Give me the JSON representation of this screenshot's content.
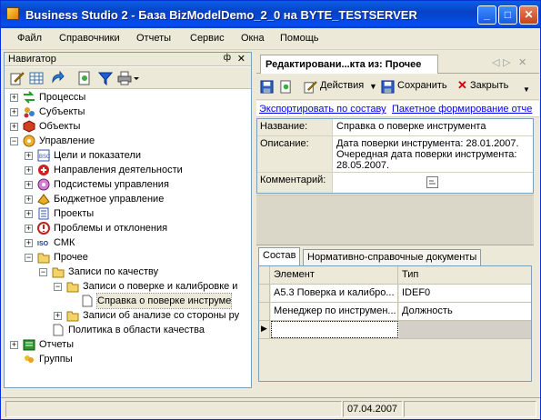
{
  "window": {
    "title": "Business Studio 2 - База BizModelDemo_2_0 на BYTE_TESTSERVER",
    "buttons": {
      "minimize": "_",
      "maximize": "□",
      "close": "✕"
    }
  },
  "menu": [
    "Файл",
    "Справочники",
    "Отчеты",
    "Сервис",
    "Окна",
    "Помощь"
  ],
  "navigator": {
    "title": "Навигатор",
    "pin": "ф",
    "close": "✕",
    "tree": [
      {
        "label": "Процессы",
        "level": 0,
        "expander": "+",
        "icon": "processes-icon"
      },
      {
        "label": "Субъекты",
        "level": 0,
        "expander": "+",
        "icon": "subjects-icon"
      },
      {
        "label": "Объекты",
        "level": 0,
        "expander": "+",
        "icon": "objects-icon"
      },
      {
        "label": "Управление",
        "level": 0,
        "expander": "−",
        "icon": "management-icon"
      },
      {
        "label": "Цели и показатели",
        "level": 1,
        "expander": "+",
        "icon": "bsc-icon"
      },
      {
        "label": "Направления деятельности",
        "level": 1,
        "expander": "+",
        "icon": "directions-icon"
      },
      {
        "label": "Подсистемы управления",
        "level": 1,
        "expander": "+",
        "icon": "subsystems-icon"
      },
      {
        "label": "Бюджетное управление",
        "level": 1,
        "expander": "+",
        "icon": "budget-icon"
      },
      {
        "label": "Проекты",
        "level": 1,
        "expander": "+",
        "icon": "projects-icon"
      },
      {
        "label": "Проблемы и отклонения",
        "level": 1,
        "expander": "+",
        "icon": "problems-icon"
      },
      {
        "label": "СМК",
        "level": 1,
        "expander": "+",
        "icon": "iso-icon"
      },
      {
        "label": "Прочее",
        "level": 1,
        "expander": "−",
        "icon": "folder-icon"
      },
      {
        "label": "Записи по качеству",
        "level": 2,
        "expander": "−",
        "icon": "folder-icon"
      },
      {
        "label": "Записи о поверке и калибровке и",
        "level": 3,
        "expander": "−",
        "icon": "folder-icon"
      },
      {
        "label": "Справка о поверке инструме",
        "level": 4,
        "expander": "",
        "icon": "document-icon",
        "selected": true
      },
      {
        "label": "Записи об анализе со стороны ру",
        "level": 3,
        "expander": "+",
        "icon": "folder-icon"
      },
      {
        "label": "Политика в области качества",
        "level": 2,
        "expander": "",
        "icon": "document-icon"
      },
      {
        "label": "Отчеты",
        "level": 0,
        "expander": "+",
        "icon": "reports-icon"
      },
      {
        "label": "Группы",
        "level": 0,
        "expander": "",
        "icon": "groups-icon"
      }
    ]
  },
  "editor": {
    "tab_title": "Редактировани...кта из: Прочее",
    "toolbar": {
      "actions": "Действия",
      "save": "Сохранить",
      "close": "Закрыть"
    },
    "links": {
      "export": "Экспортировать по составу",
      "batch": "Пакетное формирование отче"
    },
    "fields": {
      "name_label": "Название:",
      "name_value": "Справка о поверке инструмента",
      "desc_label": "Описание:",
      "desc_value": "Дата поверки инструмента: 28.01.2007. Очередная дата поверки инструмента: 28.05.2007.",
      "comment_label": "Комментарий:"
    },
    "tabs": [
      "Состав",
      "Нормативно-справочные документы"
    ],
    "grid": {
      "headers": [
        "Элемент",
        "Тип"
      ],
      "rows": [
        [
          "А5.3 Поверка и калибро...",
          "IDEF0"
        ],
        [
          "Менеджер по инструмен...",
          "Должность"
        ]
      ]
    }
  },
  "status": {
    "date": "07.04.2007"
  }
}
